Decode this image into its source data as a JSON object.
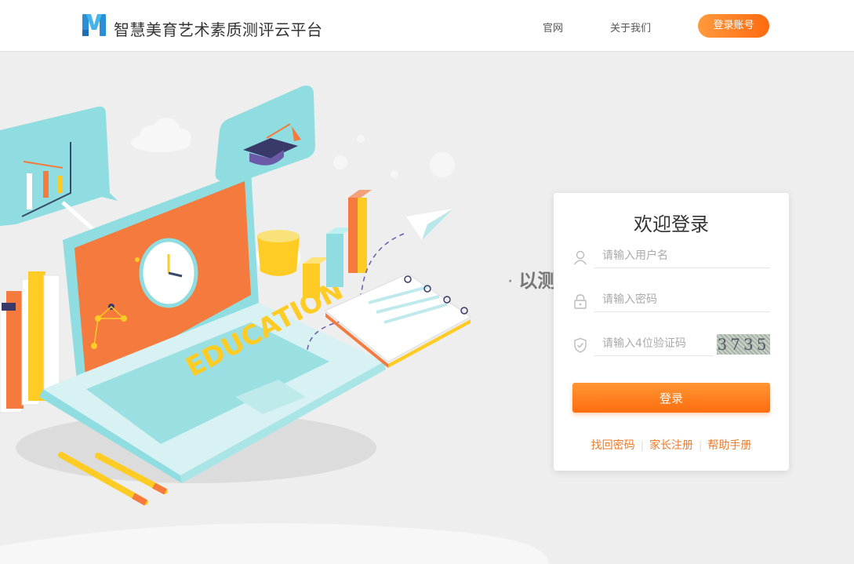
{
  "header": {
    "site_title": "智慧美育艺术素质测评云平台",
    "logo_letter": "M",
    "nav": {
      "home": "官网",
      "about": "关于我们"
    },
    "login_account_button": "登录账号"
  },
  "hero": {
    "slogan_dot": "·",
    "slogan": "以测促改",
    "illustration_word": "EDUCATION"
  },
  "login": {
    "title": "欢迎登录",
    "username_placeholder": "请输入用户名",
    "password_placeholder": "请输入密码",
    "code_placeholder": "请输入4位验证码",
    "captcha_text": "3735",
    "submit_label": "登录",
    "links": {
      "forgot": "找回密码",
      "parent_register": "家长注册",
      "help": "帮助手册"
    }
  },
  "icons": {
    "username": "user-icon",
    "password": "lock-icon",
    "code": "shield-icon"
  },
  "colors": {
    "accent": "#ff7a1f",
    "link": "#ef7a2a",
    "background": "#eeeeee",
    "teal": "#8fdde0",
    "orange_screen": "#f47a3d"
  }
}
